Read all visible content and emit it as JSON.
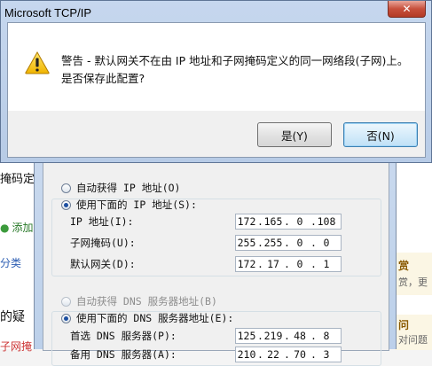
{
  "background": {
    "left_texts": [
      "掩码定",
      "添加",
      "分类",
      "的疑",
      "子网掩"
    ],
    "right_texts": [
      "赏",
      "赏，更",
      "问",
      "对问题"
    ]
  },
  "props_dialog": {
    "auto_ip_label": "自动获得 IP 地址(O)",
    "use_ip_label": "使用下面的 IP 地址(S):",
    "fields": [
      {
        "label": "IP 地址(I):",
        "octets": [
          "172",
          "165",
          "0",
          "108"
        ]
      },
      {
        "label": "子网掩码(U):",
        "octets": [
          "255",
          "255",
          "0",
          "0"
        ]
      },
      {
        "label": "默认网关(D):",
        "octets": [
          "172",
          "17",
          "0",
          "1"
        ]
      }
    ],
    "auto_dns_label": "自动获得 DNS 服务器地址(B)",
    "use_dns_label": "使用下面的 DNS 服务器地址(E):",
    "dns_fields": [
      {
        "label": "首选 DNS 服务器(P):",
        "octets": [
          "125",
          "219",
          "48",
          "8"
        ]
      },
      {
        "label": "备用 DNS 服务器(A):",
        "octets": [
          "210",
          "22",
          "70",
          "3"
        ]
      }
    ]
  },
  "warning_dialog": {
    "title": "Microsoft TCP/IP",
    "close_glyph": "✕",
    "message_line1": "警告 - 默认网关不在由 IP 地址和子网掩码定义的同一网络段(子网)上。",
    "message_line2": "是否保存此配置?",
    "yes_label": "是(Y)",
    "no_label": "否(N)",
    "icon": "warning-icon"
  }
}
